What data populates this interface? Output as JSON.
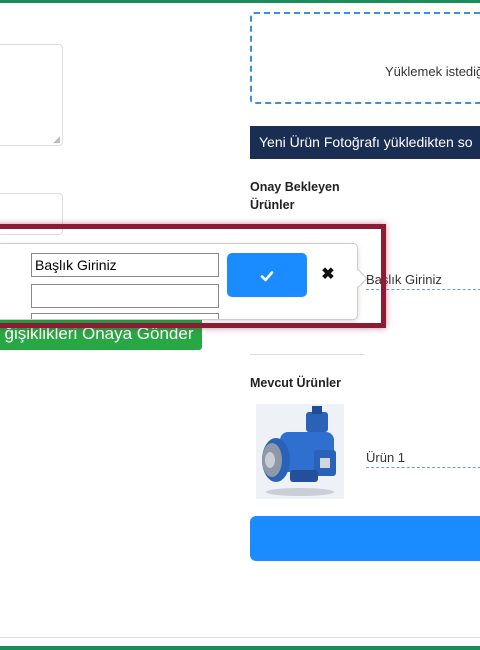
{
  "upload": {
    "text": "Yüklemek istediğ"
  },
  "notice": {
    "text": "Yeni Ürün Fotoğrafı yükledikten so"
  },
  "pending": {
    "title": "Onay Bekleyen Ürünler"
  },
  "editor": {
    "title_value": "Başlık Giriniz",
    "second_value": "",
    "confirm_icon": "check-icon",
    "cancel_icon": "close-icon",
    "cancel_glyph": "✖",
    "link_text": "Başlık Giriniz"
  },
  "submit": {
    "label": "ğişiklikleri Onaya Gönder"
  },
  "current": {
    "title": "Mevcut Ürünler",
    "items": [
      {
        "name": "Ürün 1",
        "image": "hydraulic-pump-image"
      }
    ]
  },
  "colors": {
    "green": "#28a745",
    "navy": "#1a2e54",
    "blue": "#1a8cff",
    "highlight": "#8c1c35"
  }
}
